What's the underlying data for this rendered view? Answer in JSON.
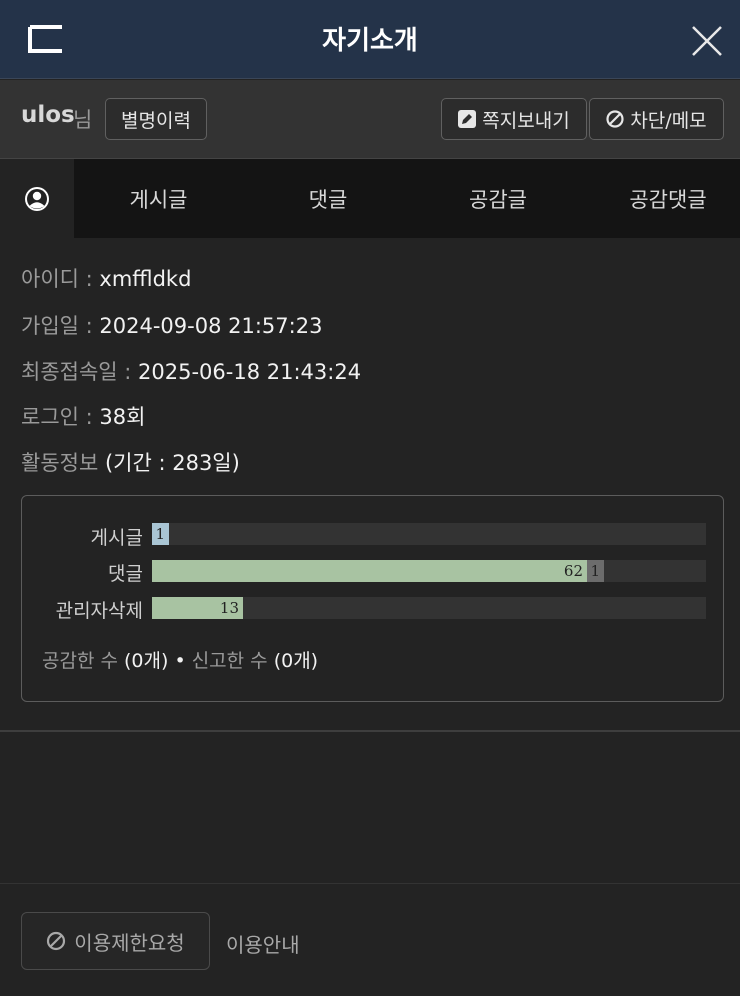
{
  "header": {
    "title": "자기소개",
    "logo_icon": "brand-logo-icon",
    "close_icon": "close-icon",
    "background": "#243349"
  },
  "user": {
    "name": "ulos",
    "suffix": "님",
    "history_button": "별명이력",
    "message_button": "쪽지보내기",
    "block_button": "차단/메모"
  },
  "tabs": [
    {
      "label": "게시글"
    },
    {
      "label": "댓글"
    },
    {
      "label": "공감글"
    },
    {
      "label": "공감댓글"
    }
  ],
  "profile": {
    "id_label": "아이디 : ",
    "id_value": "xmffldkd",
    "joined_label": "가입일 : ",
    "joined_value": "2024-09-08 21:57:23",
    "last_login_label": "최종접속일 : ",
    "last_login_value": "2025-06-18 21:43:24",
    "login_label": "로그인 : ",
    "login_value": "38회",
    "activity_label": "활동정보 ",
    "activity_value": "(기간 : 283일)"
  },
  "stats": {
    "rows": [
      {
        "label": "게시글",
        "main": 1,
        "deleted": 0
      },
      {
        "label": "댓글",
        "main": 62,
        "deleted": 1
      },
      {
        "label": "관리자삭제",
        "main": 13,
        "deleted": 0
      }
    ],
    "scale_max": 79,
    "colors": {
      "posts": "#a9c5d4",
      "comments": "#a8c3a2",
      "removed": "#6c6c6c"
    },
    "likes_label": "공감한 수 ",
    "likes_value": "(0개)",
    "separator": " • ",
    "reports_label": "신고한 수 ",
    "reports_value": "(0개)"
  },
  "footer": {
    "report_button": "이용제한요청",
    "guide_link": "이용안내"
  }
}
